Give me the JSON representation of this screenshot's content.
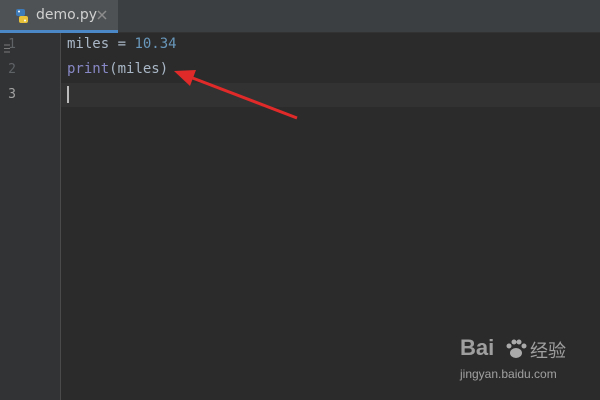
{
  "tab": {
    "label": "demo.py",
    "icon": "python-file-icon"
  },
  "gutter": {
    "line_numbers": [
      "1",
      "2",
      "3"
    ],
    "current_line": "3"
  },
  "code": {
    "line1": {
      "var": "miles",
      "op": " = ",
      "num": "10.34"
    },
    "line2": {
      "builtin": "print",
      "rest": "(miles)"
    }
  },
  "annotation": {
    "type": "red-arrow",
    "color": "#e02a2a"
  },
  "watermark": {
    "brand": "Bai",
    "brand_suffix": "经验",
    "url": "jingyan.baidu.com"
  },
  "colors": {
    "editor_bg": "#2b2b2b",
    "gutter_bg": "#313335",
    "tab_underline": "#4a88c7",
    "number": "#6897bb",
    "builtin": "#8888c6",
    "text": "#a9b7c6"
  }
}
